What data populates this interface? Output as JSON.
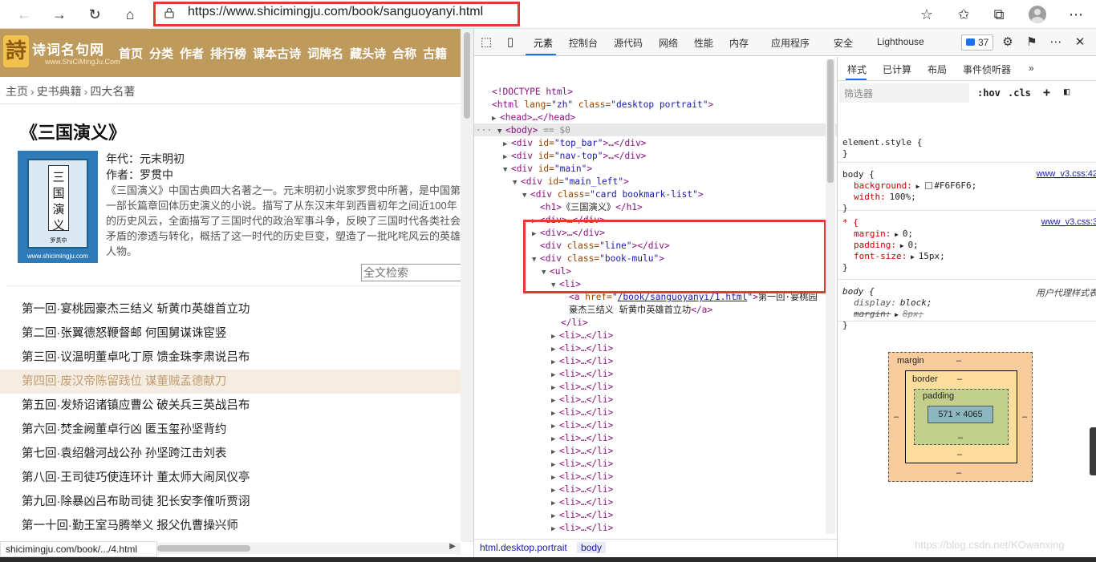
{
  "browser": {
    "url": "https://www.shicimingju.com/book/sanguoyanyi.html",
    "icons": [
      "back-icon",
      "forward-icon",
      "refresh-icon",
      "home-icon",
      "lock-icon",
      "add-favorite-icon",
      "favorites-icon",
      "collections-icon",
      "profile-avatar",
      "more-icon"
    ]
  },
  "site": {
    "logo_text": "诗词名句网",
    "logo_sub": "www.ShiCiMingJu.Com",
    "nav": [
      "首页",
      "分类",
      "作者",
      "排行榜",
      "课本古诗",
      "词牌名",
      "藏头诗",
      "合称",
      "古籍"
    ],
    "breadcrumb": [
      "主页",
      "史书典籍",
      "四大名著"
    ],
    "book": {
      "title": "《三国演义》",
      "cover_text": "三国演义",
      "cover_sub": "罗贯中",
      "cover_site": "www.shicimingju.com",
      "era": "年代：元末明初",
      "author": "作者：罗贯中",
      "description": "《三国演义》中国古典四大名著之一。元末明初小说家罗贯中所著，是中国第一部长篇章回体历史演义的小说。描写了从东汉末年到西晋初年之间近100年的历史风云，全面描写了三国时代的政治军事斗争，反映了三国时代各类社会矛盾的渗透与转化，概括了这一时代的历史巨变，塑造了一批叱咤风云的英雄人物。"
    },
    "search_placeholder": "全文检索",
    "chapters": [
      "第一回·宴桃园豪杰三结义 斩黄巾英雄首立功",
      "第二回·张翼德怒鞭督邮 何国舅谋诛宦竖",
      "第三回·议温明董卓叱丁原 馈金珠李肃说吕布",
      "第四回·废汉帝陈留践位 谋董贼孟德献刀",
      "第五回·发矫诏诸镇应曹公 破关兵三英战吕布",
      "第六回·焚金阙董卓行凶 匿玉玺孙坚背约",
      "第七回·袁绍磐河战公孙 孙坚跨江击刘表",
      "第八回·王司徒巧使连环计 董太师大闹凤仪亭",
      "第九回·除暴凶吕布助司徒 犯长安李傕听贾诩",
      "第一十回·勤王室马腾举义 报父仇曹操兴师"
    ],
    "status_url": "shicimingju.com/book/.../4.html"
  },
  "devtools": {
    "tabs": [
      "元素",
      "控制台",
      "源代码",
      "网络",
      "性能",
      "内存",
      "应用程序",
      "安全",
      "Lighthouse"
    ],
    "issues_count": "37",
    "dom": {
      "doctype": "<!DOCTYPE html>",
      "html_open": [
        "html",
        "lang",
        "zh",
        "class",
        "desktop portrait"
      ],
      "head": "<head>…</head>",
      "body_marker": "== $0",
      "top_bar": [
        "div",
        "id",
        "top_bar"
      ],
      "nav_top": [
        "div",
        "id",
        "nav-top"
      ],
      "main": [
        "div",
        "id",
        "main"
      ],
      "main_left": [
        "div",
        "id",
        "main_left"
      ],
      "card": [
        "div",
        "class",
        "card bookmark-list"
      ],
      "h1_text": "《三国演义》",
      "div_collapsed": "<div>…</div>",
      "line_div": [
        "div",
        "class",
        "line"
      ],
      "mulu": [
        "div",
        "class",
        "book-mulu"
      ],
      "ul": "<ul>",
      "li": "<li>",
      "a_href": "/book/sanguoyanyi/1.html",
      "a_text_1": "第一回·宴桃园",
      "a_text_2": "豪杰三结义  斩黄巾英雄首立功",
      "li_close": "</li>",
      "li_collapsed": "<li>…</li>",
      "li_rows": 18
    },
    "breadcrumb": [
      "html.desktop.portrait",
      "body"
    ],
    "styles": {
      "tabs": [
        "样式",
        "已计算",
        "布局",
        "事件侦听器",
        "»"
      ],
      "filter_placeholder": "筛选器",
      "hov": ":hov",
      "cls": ".cls",
      "rules": [
        {
          "selector": "element.style {",
          "lines": [],
          "source": ""
        },
        {
          "selector": "body {",
          "lines": [
            [
              "background:",
              "#F6F6F6;"
            ],
            [
              "width:",
              "100%;"
            ]
          ],
          "source": "www_v3.css:42"
        },
        {
          "selector": "* {",
          "lines": [
            [
              "margin:",
              "0;"
            ],
            [
              "padding:",
              "0;"
            ],
            [
              "font-size:",
              "15px;"
            ]
          ],
          "source": "www_v3.css:3"
        },
        {
          "selector": "body {",
          "lines": [
            [
              "display:",
              "block;"
            ],
            [
              "margin:",
              "8px;"
            ]
          ],
          "source": "用户代理样式表"
        }
      ],
      "box": {
        "margin": "margin",
        "border": "border",
        "padding": "padding",
        "dash": "–",
        "content": "571 × 4065"
      }
    }
  },
  "watermark": "https://blog.csdn.net/KOwanxing",
  "colors": {
    "accent": "#1a73e8",
    "highlight": "#e53935",
    "site_nav": "#bf9a5d"
  }
}
